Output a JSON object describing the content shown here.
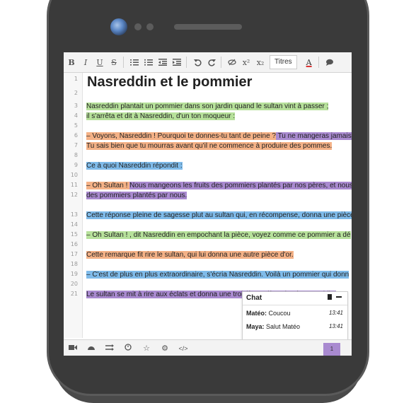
{
  "toolbar": {
    "bold": "B",
    "italic": "I",
    "underline": "U",
    "strike": "S",
    "superscript": "x²",
    "subscript": "x₂",
    "style_select": "Titres",
    "text_color": "A"
  },
  "line_numbers": [
    "1",
    "2",
    "3",
    "4",
    "5",
    "6",
    "7",
    "8",
    "9",
    "10",
    "11",
    "12",
    "13",
    "14",
    "15",
    "16",
    "17",
    "18",
    "19",
    "20",
    "21"
  ],
  "document": {
    "title": "Nasreddin et le pommier",
    "lines": [
      "Nasreddin plantait un pommier dans son jardin quand le sultan vint à passer ;",
      " il s'arrêta et dit à Nasreddin, d'un ton moqueur :",
      "– Voyons, Nasreddin ! Pourquoi te donnes-tu tant de peine ?",
      " Tu ne mangeras jamais",
      "Tu sais bien que tu mourras avant qu'il ne commence à produire des pommes.",
      "Ce à quoi Nasreddin répondit :",
      "– Oh Sultan ! ",
      "Nous mangeons les fruits des pommiers plantés par nos pères, et nous",
      "des pommiers plantés par nous.",
      "Cette réponse pleine de sagesse plut au sultan qui, en récompense, donna une pièce",
      "– Oh Sultan ! , dit Nasreddin en empochant la pièce, voyez comme ce pommier a dé",
      "Cette remarque fit rire le sultan, qui lui donna une autre pièce d'or.",
      "– C'est de plus en plus extraordinaire, s'écria Nasreddin. Voilà un pommier qui donn",
      "Le sultan se mit à rire aux éclats et donna une troisième pièce d'or à Nasreddin."
    ]
  },
  "chat": {
    "title": "Chat",
    "messages": [
      {
        "author": "Matéo:",
        "text": " Coucou",
        "time": "13:41"
      },
      {
        "author": "Maya:",
        "text": " Salut Matéo",
        "time": "13:41"
      }
    ]
  },
  "status": {
    "users_count": "1"
  },
  "colors": {
    "green": "#b7e19b",
    "orange": "#f4b186",
    "purple": "#a98ad0",
    "blue": "#7fbbea"
  }
}
